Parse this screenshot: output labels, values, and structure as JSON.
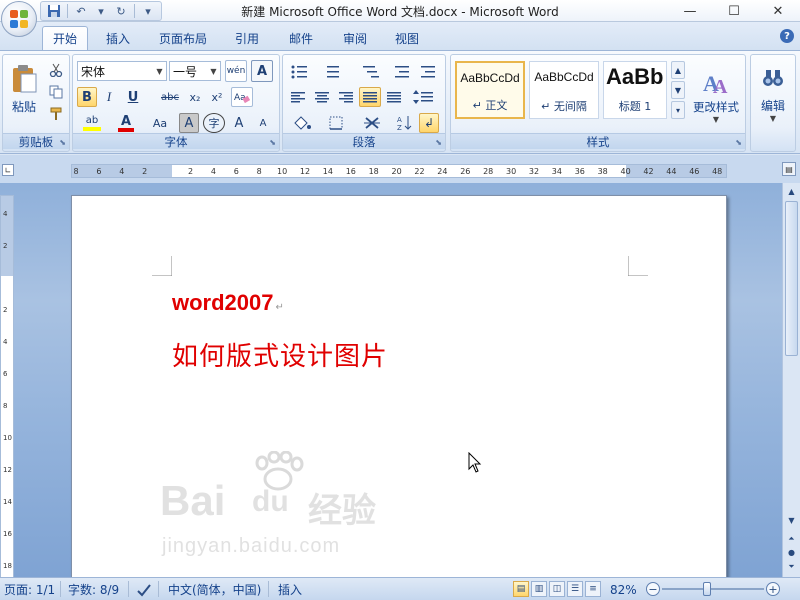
{
  "window": {
    "title": "新建 Microsoft Office Word 文档.docx - Microsoft Word",
    "minimize": "—",
    "maximize": "☐",
    "close": "✕"
  },
  "qat": {
    "save": "💾",
    "undo": "↶",
    "redo": "↻",
    "more": "▾"
  },
  "tabs": [
    "开始",
    "插入",
    "页面布局",
    "引用",
    "邮件",
    "审阅",
    "视图"
  ],
  "help": "?",
  "ribbon": {
    "clipboard": {
      "label": "剪贴板",
      "paste": "粘贴"
    },
    "font": {
      "label": "字体",
      "font_name": "宋体",
      "font_size": "一号",
      "phonetic": "wén",
      "bold": "B",
      "italic": "I",
      "underline": "U",
      "strike": "abc",
      "sub": "x₂",
      "sup": "x²",
      "highlight": "ab",
      "font_color": "A",
      "case": "Aa",
      "char_shade": "A",
      "enclose": "字",
      "grow": "A",
      "shrink": "A"
    },
    "paragraph": {
      "label": "段落"
    },
    "styles": {
      "label": "样式",
      "items": [
        {
          "sample": "AaBbCcDd",
          "name": "↵ 正文"
        },
        {
          "sample": "AaBbCcDd",
          "name": "↵ 无间隔"
        },
        {
          "sample": "AaBb",
          "name": "标题 1"
        }
      ],
      "change_styles": "更改样式"
    },
    "editing": {
      "label": "编辑"
    }
  },
  "ruler": {
    "ticks": [
      "8",
      "6",
      "4",
      "2",
      "",
      "2",
      "4",
      "6",
      "8",
      "10",
      "12",
      "14",
      "16",
      "18",
      "20",
      "22",
      "24",
      "26",
      "28",
      "30",
      "32",
      "34",
      "36",
      "38",
      "40",
      "42",
      "44",
      "46",
      "48"
    ],
    "vticks": [
      "4",
      "2",
      "",
      "2",
      "4",
      "6",
      "8",
      "10",
      "12",
      "14",
      "16",
      "18"
    ]
  },
  "document": {
    "line1": "word2007",
    "line2": "如何版式设计图片",
    "para_mark": "↵"
  },
  "watermark": {
    "brand": "Bai",
    "brand2": "du",
    "cn": "经验",
    "url": "jingyan.baidu.com"
  },
  "status": {
    "page": "页面: 1/1",
    "words": "字数: 8/9",
    "language": "中文(简体，中国)",
    "mode": "插入",
    "zoom": "82%",
    "zoom_minus": "−",
    "zoom_plus": "+"
  },
  "colors": {
    "doc_text": "#e00000",
    "ribbon_text": "#15428b"
  }
}
